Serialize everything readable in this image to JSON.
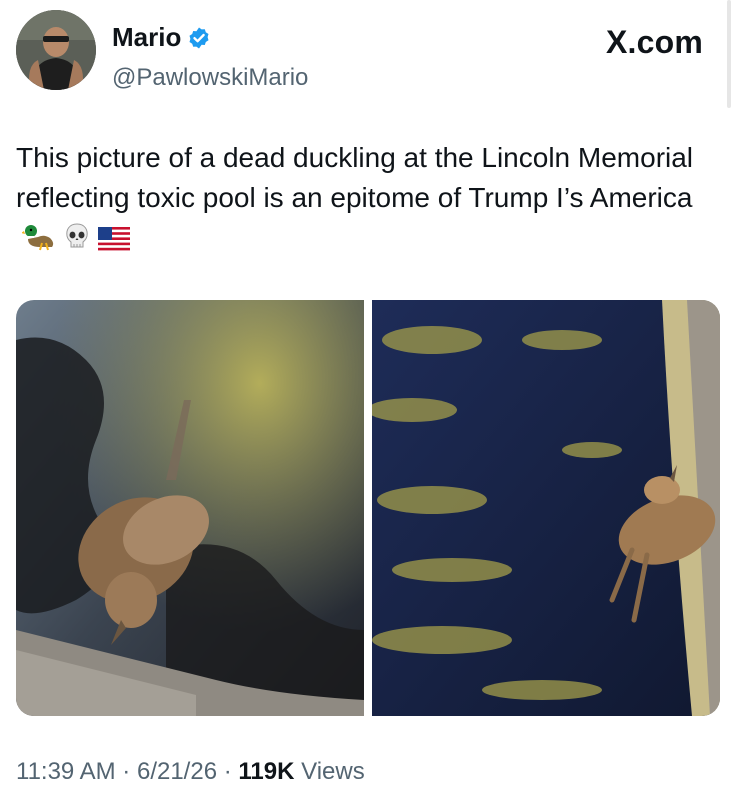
{
  "author": {
    "name": "Mario",
    "handle": "@PawlowskiMario",
    "verified": true
  },
  "watermark": "X.com",
  "tweet": {
    "text": "This picture of a dead duckling at the Lincoln Memorial reflecting toxic pool is an epitome of Trump I’s America",
    "emojis": [
      "duck-emoji",
      "skull-emoji",
      "us-flag-emoji"
    ]
  },
  "media": {
    "photos": [
      "photo-dead-duckling-1",
      "photo-dead-duckling-2"
    ]
  },
  "meta": {
    "time": "11:39 AM",
    "date": "6/21/26",
    "views_count": "119K",
    "views_label": "Views",
    "separator": "·"
  },
  "colors": {
    "verified_blue": "#1d9bf0",
    "text_primary": "#0f1419",
    "text_secondary": "#536471"
  }
}
